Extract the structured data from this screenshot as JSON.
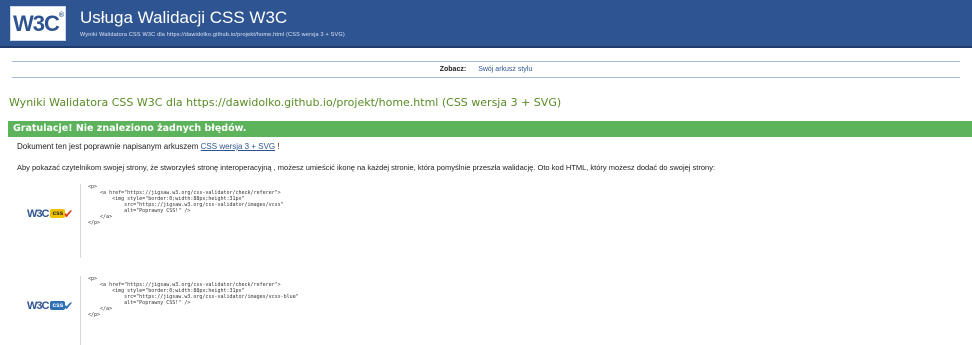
{
  "header": {
    "logo_text": "W3C",
    "logo_mark": "®",
    "title": "Usługa Walidacji CSS W3C",
    "subtitle": "Wyniki Walidatora CSS W3C dla https://dawidolko.github.io/projekt/home.html (CSS wersja 3 + SVG)",
    "background_color": "#2f5492"
  },
  "see_bar": {
    "label": "Zobacz:",
    "link": "Swój arkusz stylu"
  },
  "results": {
    "title": "Wyniki Walidatora CSS W3C dla https://dawidolko.github.io/projekt/home.html (CSS wersja 3 + SVG)",
    "congrats": "Gratulacje! Nie znaleziono żadnych błędów.",
    "congrats_color": "#5cb35c",
    "doc_prefix": "Dokument ten jest poprawnie napisanym arkuszem",
    "doc_link": "CSS wersja 3 + SVG",
    "doc_suffix": "!",
    "info": "Aby pokazać czytelnikom swojej strony, że stworzyłeś stronę interoperacyjną , możesz umieścić ikonę na każdej stronie, która pomyślnie przeszła walidację. Oto kod HTML, który możesz dodać do swojej strony:"
  },
  "badges": [
    {
      "w3c": "W3C",
      "css": "css",
      "check": "✔",
      "icon": "css-valid-gold-badge-icon",
      "code": "<p>\n    <a href=\"https://jigsaw.w3.org/css-validator/check/referer\">\n        <img style=\"border:0;width:88px;height:31px\"\n            src=\"https://jigsaw.w3.org/css-validator/images/vcss\"\n            alt=\"Poprawny CSS!\" />\n    </a>\n</p>"
    },
    {
      "w3c": "W3C",
      "css": "css",
      "check": "✔",
      "icon": "css-valid-blue-badge-icon",
      "code": "<p>\n    <a href=\"https://jigsaw.w3.org/css-validator/check/referer\">\n        <img style=\"border:0;width:88px;height:31px\"\n            src=\"https://jigsaw.w3.org/css-validator/images/vcss-blue\"\n            alt=\"Poprawny CSS!\" />\n    </a>\n</p>"
    }
  ]
}
